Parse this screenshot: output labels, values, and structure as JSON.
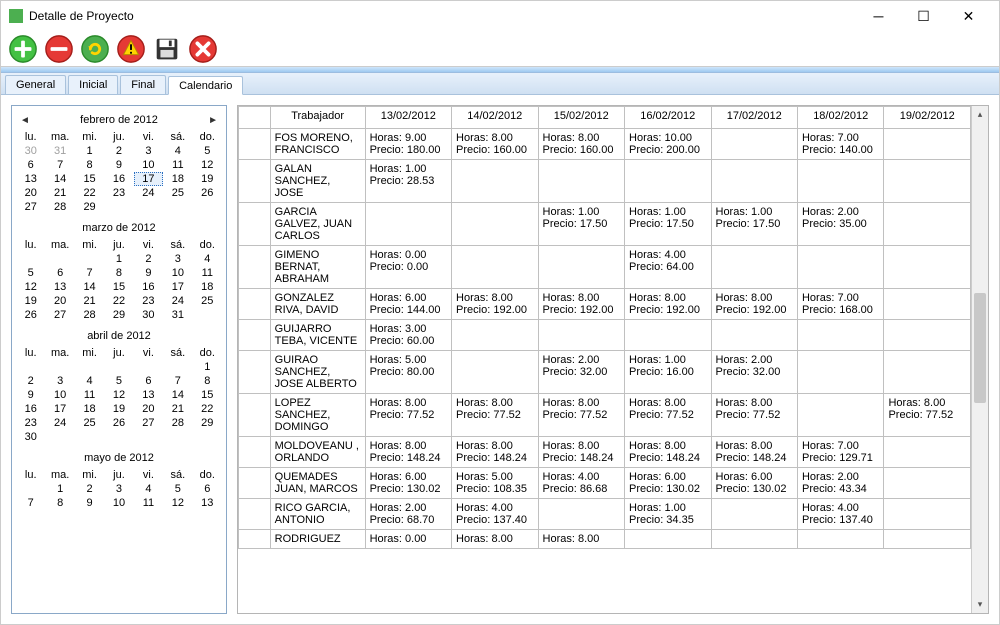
{
  "window": {
    "title": "Detalle de Proyecto"
  },
  "tabs": [
    "General",
    "Inicial",
    "Final",
    "Calendario"
  ],
  "active_tab": 3,
  "calendar": {
    "day_headers": [
      "lu.",
      "ma.",
      "mi.",
      "ju.",
      "vi.",
      "sá.",
      "do."
    ],
    "months": [
      {
        "title": "febrero de 2012",
        "show_nav": true,
        "lead_gray": [
          30,
          31
        ],
        "days": 29,
        "selected": 17
      },
      {
        "title": "marzo de 2012",
        "show_nav": false,
        "lead_blank": 3,
        "days": 31
      },
      {
        "title": "abril de 2012",
        "show_nav": false,
        "lead_blank": 6,
        "days": 30
      },
      {
        "title": "mayo de 2012",
        "show_nav": false,
        "lead_blank": 1,
        "days": 13
      }
    ]
  },
  "grid": {
    "worker_header": "Trabajador",
    "dates": [
      "13/02/2012",
      "14/02/2012",
      "15/02/2012",
      "16/02/2012",
      "17/02/2012",
      "18/02/2012",
      "19/02/2012"
    ],
    "labels": {
      "hours": "Horas",
      "price": "Precio"
    },
    "rows": [
      {
        "name": "FOS MORENO, FRANCISCO",
        "cells": [
          {
            "h": "9.00",
            "p": "180.00"
          },
          {
            "h": "8.00",
            "p": "160.00"
          },
          {
            "h": "8.00",
            "p": "160.00"
          },
          {
            "h": "10.00",
            "p": "200.00"
          },
          null,
          {
            "h": "7.00",
            "p": "140.00"
          },
          null
        ]
      },
      {
        "name": "GALAN SANCHEZ, JOSE",
        "cells": [
          {
            "h": "1.00",
            "p": "28.53"
          },
          null,
          null,
          null,
          null,
          null,
          null
        ]
      },
      {
        "name": "GARCIA GALVEZ, JUAN CARLOS",
        "cells": [
          null,
          null,
          {
            "h": "1.00",
            "p": "17.50"
          },
          {
            "h": "1.00",
            "p": "17.50"
          },
          {
            "h": "1.00",
            "p": "17.50"
          },
          {
            "h": "2.00",
            "p": "35.00"
          },
          null
        ]
      },
      {
        "name": "GIMENO BERNAT, ABRAHAM",
        "cells": [
          {
            "h": "0.00",
            "p": "0.00"
          },
          null,
          null,
          {
            "h": "4.00",
            "p": "64.00"
          },
          null,
          null,
          null
        ]
      },
      {
        "name": "GONZALEZ RIVA, DAVID",
        "cells": [
          {
            "h": "6.00",
            "p": "144.00"
          },
          {
            "h": "8.00",
            "p": "192.00"
          },
          {
            "h": "8.00",
            "p": "192.00"
          },
          {
            "h": "8.00",
            "p": "192.00"
          },
          {
            "h": "8.00",
            "p": "192.00"
          },
          {
            "h": "7.00",
            "p": "168.00"
          },
          null
        ]
      },
      {
        "name": "GUIJARRO TEBA, VICENTE",
        "cells": [
          {
            "h": "3.00",
            "p": "60.00"
          },
          null,
          null,
          null,
          null,
          null,
          null
        ]
      },
      {
        "name": "GUIRAO SANCHEZ, JOSE ALBERTO",
        "cells": [
          {
            "h": "5.00",
            "p": "80.00"
          },
          null,
          {
            "h": "2.00",
            "p": "32.00"
          },
          {
            "h": "1.00",
            "p": "16.00"
          },
          {
            "h": "2.00",
            "p": "32.00"
          },
          null,
          null
        ]
      },
      {
        "name": "LOPEZ SANCHEZ, DOMINGO",
        "cells": [
          {
            "h": "8.00",
            "p": "77.52"
          },
          {
            "h": "8.00",
            "p": "77.52"
          },
          {
            "h": "8.00",
            "p": "77.52"
          },
          {
            "h": "8.00",
            "p": "77.52"
          },
          {
            "h": "8.00",
            "p": "77.52"
          },
          null,
          {
            "h": "8.00",
            "p": "77.52"
          }
        ]
      },
      {
        "name": "MOLDOVEANU , ORLANDO",
        "cells": [
          {
            "h": "8.00",
            "p": "148.24"
          },
          {
            "h": "8.00",
            "p": "148.24"
          },
          {
            "h": "8.00",
            "p": "148.24"
          },
          {
            "h": "8.00",
            "p": "148.24"
          },
          {
            "h": "8.00",
            "p": "148.24"
          },
          {
            "h": "7.00",
            "p": "129.71"
          },
          null
        ]
      },
      {
        "name": "QUEMADES JUAN, MARCOS",
        "cells": [
          {
            "h": "6.00",
            "p": "130.02"
          },
          {
            "h": "5.00",
            "p": "108.35"
          },
          {
            "h": "4.00",
            "p": "86.68"
          },
          {
            "h": "6.00",
            "p": "130.02"
          },
          {
            "h": "6.00",
            "p": "130.02"
          },
          {
            "h": "2.00",
            "p": "43.34"
          },
          null
        ]
      },
      {
        "name": "RICO GARCIA, ANTONIO",
        "cells": [
          {
            "h": "2.00",
            "p": "68.70"
          },
          {
            "h": "4.00",
            "p": "137.40"
          },
          null,
          {
            "h": "1.00",
            "p": "34.35"
          },
          null,
          {
            "h": "4.00",
            "p": "137.40"
          },
          null
        ]
      },
      {
        "name": "RODRIGUEZ",
        "cells": [
          {
            "h": "0.00"
          },
          {
            "h": "8.00"
          },
          {
            "h": "8.00"
          },
          null,
          null,
          null,
          null
        ]
      }
    ]
  }
}
